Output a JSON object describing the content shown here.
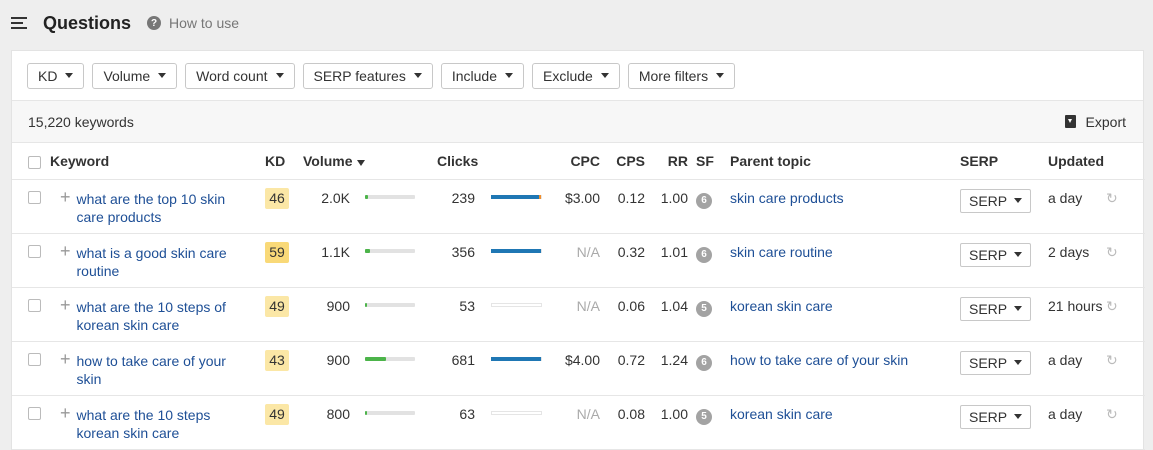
{
  "header": {
    "title": "Questions",
    "help_icon": "?",
    "how_to_use": "How to use"
  },
  "filters": [
    "KD",
    "Volume",
    "Word count",
    "SERP features",
    "Include",
    "Exclude",
    "More filters"
  ],
  "summary": {
    "keyword_count": "15,220 keywords",
    "export_label": "Export"
  },
  "columns": {
    "keyword": "Keyword",
    "kd": "KD",
    "volume": "Volume",
    "clicks": "Clicks",
    "cpc": "CPC",
    "cps": "CPS",
    "rr": "RR",
    "sf": "SF",
    "parent_topic": "Parent topic",
    "serp": "SERP",
    "updated": "Updated"
  },
  "sort": {
    "column": "volume",
    "direction": "desc"
  },
  "colors": {
    "kd_easy": "#fbe7a6",
    "kd_medium": "#f9d978",
    "volume_bar": "#4cb44a",
    "clicks_bar": "#1f77b4",
    "paid_clicks": "#f28e2b",
    "link": "#1e4f96"
  },
  "rows": [
    {
      "keyword": "what are the top 10 skin care products",
      "kd": "46",
      "kd_level": "easy",
      "volume": "2.0K",
      "volume_level": 0.06,
      "clicks": "239",
      "clicks_share": 0.94,
      "paid_share": 0.04,
      "cpc": "$3.00",
      "cps": "0.12",
      "rr": "1.00",
      "sf": "6",
      "parent_topic": "skin care products",
      "serp": "SERP",
      "updated": "a day"
    },
    {
      "keyword": "what is a good skin care routine",
      "kd": "59",
      "kd_level": "medium",
      "volume": "1.1K",
      "volume_level": 0.1,
      "clicks": "356",
      "clicks_share": 0.98,
      "paid_share": 0,
      "cpc": "N/A",
      "cps": "0.32",
      "rr": "1.01",
      "sf": "6",
      "parent_topic": "skin care routine",
      "serp": "SERP",
      "updated": "2 days"
    },
    {
      "keyword": "what are the 10 steps of korean skin care",
      "kd": "49",
      "kd_level": "easy",
      "volume": "900",
      "volume_level": 0.04,
      "clicks": "53",
      "clicks_share": 0,
      "paid_share": 0,
      "cpc": "N/A",
      "cps": "0.06",
      "rr": "1.04",
      "sf": "5",
      "parent_topic": "korean skin care",
      "serp": "SERP",
      "updated": "21 hours"
    },
    {
      "keyword": "how to take care of your skin",
      "kd": "43",
      "kd_level": "easy",
      "volume": "900",
      "volume_level": 0.42,
      "clicks": "681",
      "clicks_share": 0.98,
      "paid_share": 0,
      "cpc": "$4.00",
      "cps": "0.72",
      "rr": "1.24",
      "sf": "6",
      "parent_topic": "how to take care of your skin",
      "serp": "SERP",
      "updated": "a day"
    },
    {
      "keyword": "what are the 10 steps korean skin care",
      "kd": "49",
      "kd_level": "easy",
      "volume": "800",
      "volume_level": 0.04,
      "clicks": "63",
      "clicks_share": 0,
      "paid_share": 0,
      "cpc": "N/A",
      "cps": "0.08",
      "rr": "1.00",
      "sf": "5",
      "parent_topic": "korean skin care",
      "serp": "SERP",
      "updated": "a day"
    }
  ]
}
